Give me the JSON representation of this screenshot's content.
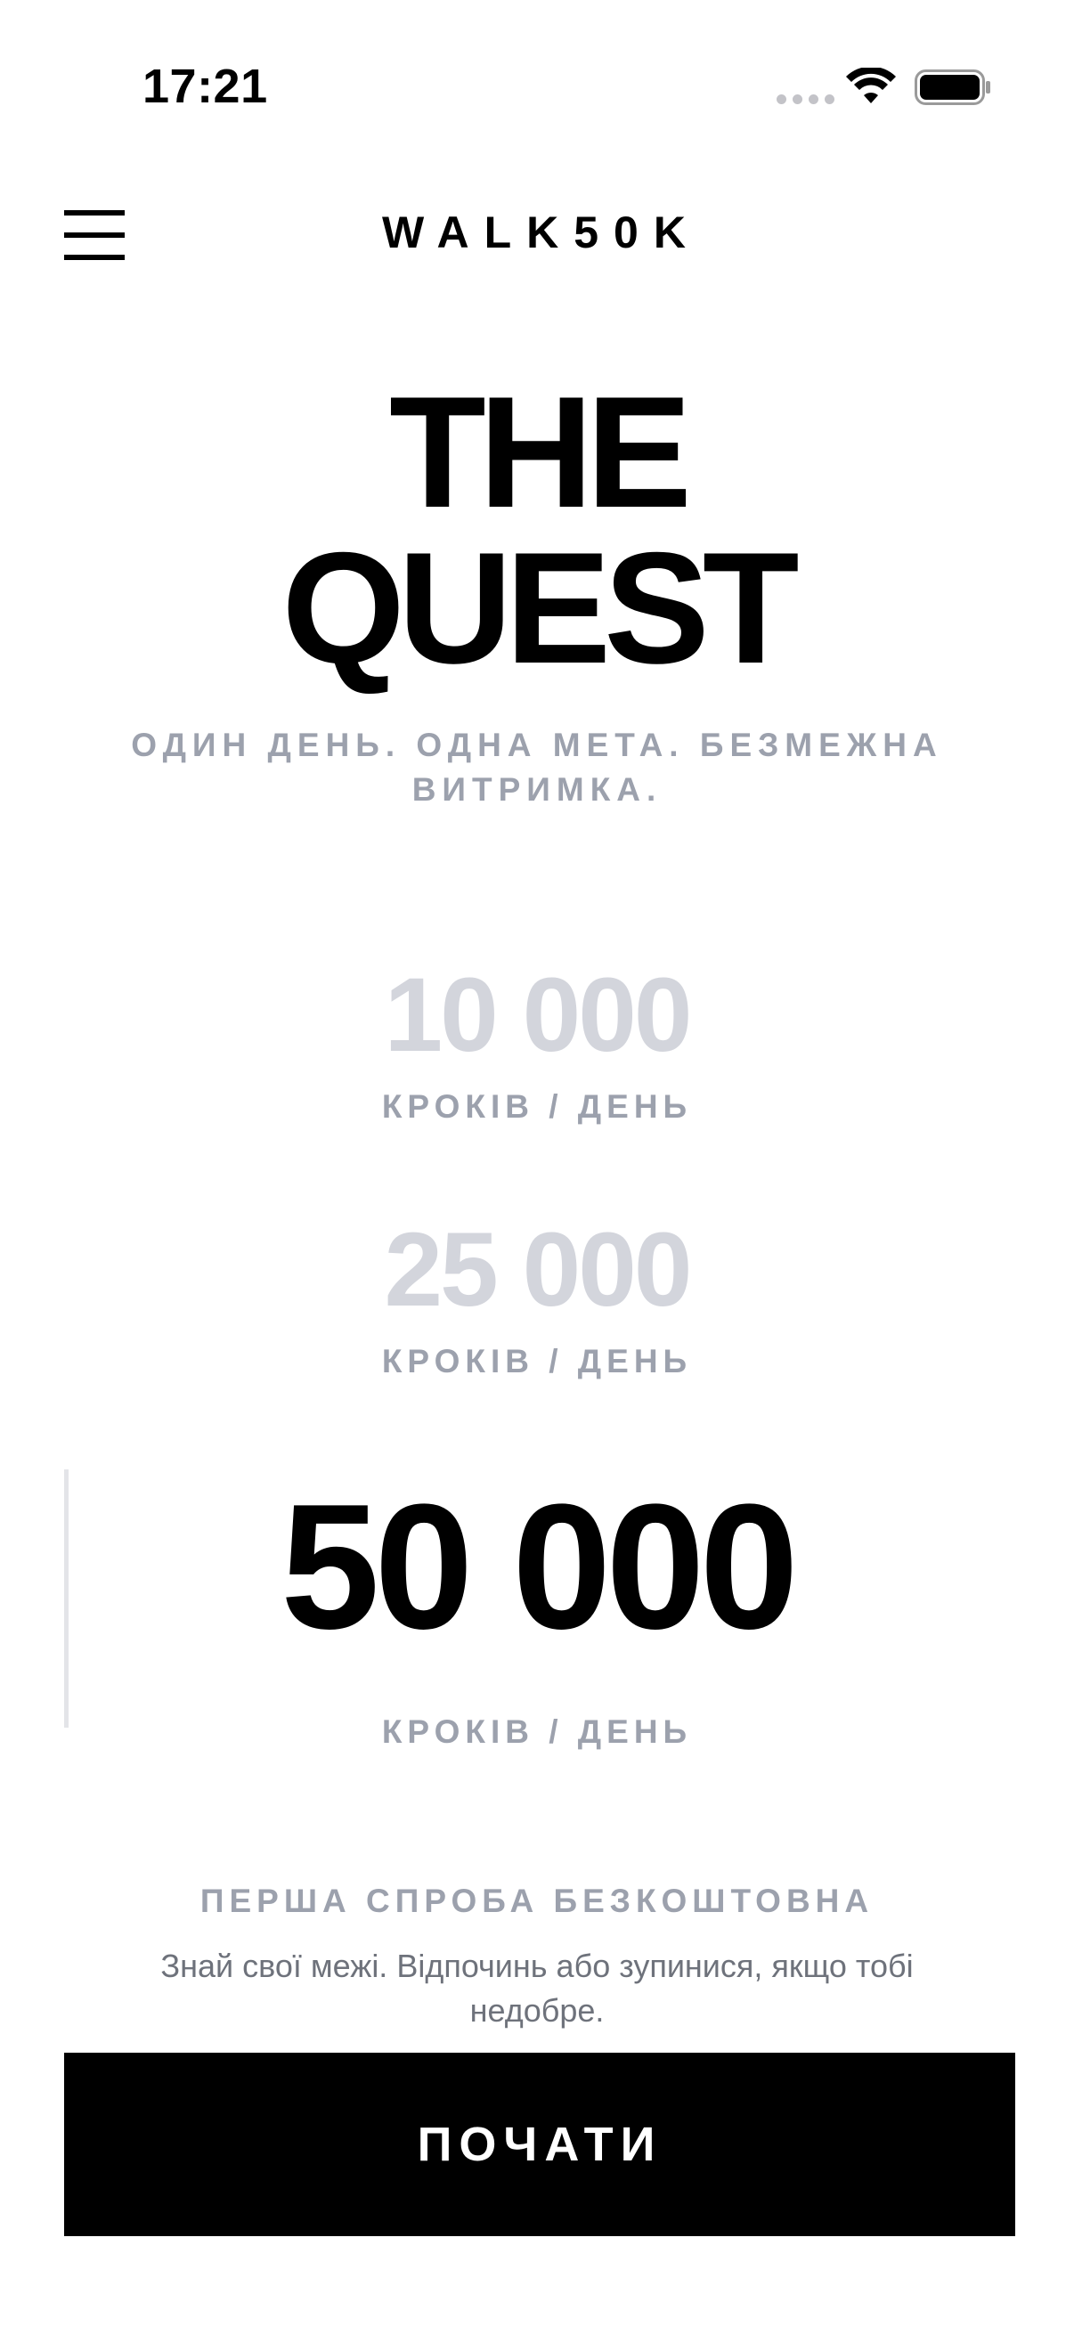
{
  "status_bar": {
    "time": "17:21"
  },
  "header": {
    "app_title": "WALK50K",
    "menu_icon": "hamburger-menu-icon"
  },
  "hero": {
    "title_line1": "THE",
    "title_line2": "QUEST",
    "subtitle": "ОДИН ДЕНЬ. ОДНА МЕТА. БЕЗМЕЖНА ВИТРИМКА."
  },
  "goals": [
    {
      "value": "10 000",
      "unit": "КРОКІВ / ДЕНЬ",
      "selected": false
    },
    {
      "value": "25 000",
      "unit": "КРОКІВ / ДЕНЬ",
      "selected": false
    },
    {
      "value": "50 000",
      "unit": "КРОКІВ / ДЕНЬ",
      "selected": true
    }
  ],
  "footer": {
    "free_label": "ПЕРША СПРОБА БЕЗКОШТОВНА",
    "disclaimer": "Знай свої межі. Відпочинь або зупинися, якщо тобі недобре.",
    "start_label": "ПОЧАТИ"
  },
  "colors": {
    "primary": "#000000",
    "muted_text": "#9ca1ad",
    "inactive_goal": "#d3d5dc",
    "background": "#ffffff"
  }
}
